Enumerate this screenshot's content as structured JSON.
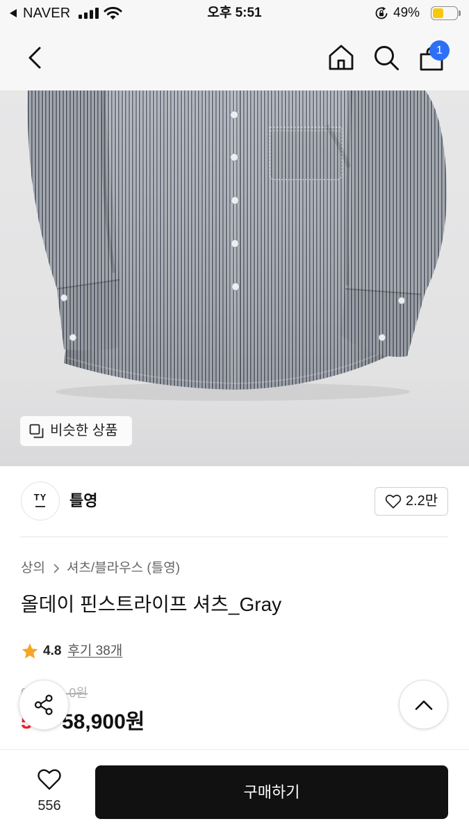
{
  "status_bar": {
    "back_app_label": "NAVER",
    "time": "오후 5:51",
    "battery_percent": "49%",
    "icons": [
      "back-to-app-icon",
      "cellular-signal-icon",
      "wifi-icon",
      "rotation-lock-icon",
      "battery-icon"
    ]
  },
  "header": {
    "icons": [
      "chevron-left-icon",
      "home-icon",
      "search-icon",
      "shopping-bag-icon"
    ],
    "cart_badge": "1"
  },
  "product_image": {
    "similar_items_label": "비슷한 상품",
    "icon": "similar-items-icon"
  },
  "brand": {
    "logo_text": "TY",
    "name": "틀영",
    "like_count": "2.2만",
    "like_icon": "heart-outline-icon"
  },
  "breadcrumb": [
    "상의",
    "셔츠/블라우스 (틀영)"
  ],
  "product": {
    "title": "올데이 핀스트라이프 셔츠_Gray",
    "rating": "4.8",
    "review_link": "후기 38개",
    "original_price_visible": [
      "9",
      "0원"
    ],
    "discount_visible": "5",
    "sale_price": "58,900원"
  },
  "floating_buttons": {
    "share_icon": "share-icon",
    "scroll_top_icon": "chevron-up-icon"
  },
  "bottom_bar": {
    "wish_icon": "heart-outline-icon",
    "wish_count": "556",
    "buy_label": "구매하기"
  },
  "colors": {
    "header_bg": "#f7f7f7",
    "badge_blue": "#2d6ff7",
    "discount_red": "#f2202e",
    "star_orange": "#f6a623",
    "buy_button": "#111111",
    "battery_yellow": "#f9c80e"
  }
}
